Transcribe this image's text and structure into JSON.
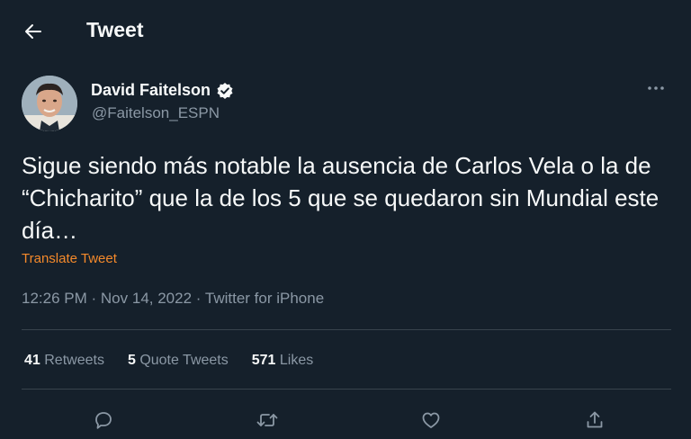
{
  "header": {
    "title": "Tweet"
  },
  "tweet": {
    "author": {
      "display_name": "David Faitelson",
      "handle": "@Faitelson_ESPN",
      "verified": true
    },
    "text": "Sigue siendo más notable la ausencia de Carlos Vela o la de “Chicharito” que la de los 5 que se quedaron sin Mundial este día…",
    "translate_label": "Translate Tweet",
    "time": "12:26 PM",
    "date": "Nov 14, 2022",
    "source": "Twitter for iPhone",
    "separator": "·",
    "stats": {
      "retweets": {
        "count": "41",
        "label": "Retweets"
      },
      "quotes": {
        "count": "5",
        "label": "Quote Tweets"
      },
      "likes": {
        "count": "571",
        "label": "Likes"
      }
    }
  },
  "icons": {
    "back": "arrow-left-icon",
    "verified": "verified-badge-icon",
    "more": "more-dots-icon",
    "reply": "reply-icon",
    "retweet": "retweet-icon",
    "like": "heart-icon",
    "share": "share-icon"
  },
  "colors": {
    "background": "#15202b",
    "text": "#f7f9f9",
    "secondary_text": "#8b98a5",
    "divider": "#38444d",
    "translate_link": "#f4892b"
  }
}
